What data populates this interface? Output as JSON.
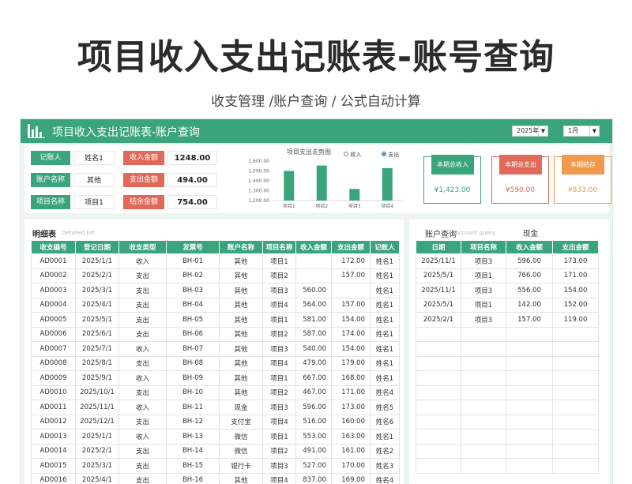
{
  "header": {
    "title": "项目收入支出记账表-账号查询",
    "subtitle": "收支管理  /账户查询  /  公式自动计算"
  },
  "sheet": {
    "title": "项目收入支出记账表-账户查询",
    "year": "2025年",
    "month": "1月"
  },
  "filters": [
    {
      "label": "记账人",
      "value": "姓名1"
    },
    {
      "label": "账户名称",
      "value": "其他"
    },
    {
      "label": "项目名称",
      "value": "项目1"
    }
  ],
  "summary": [
    {
      "label": "收入金额",
      "value": "1248.00"
    },
    {
      "label": "支出金额",
      "value": "494.00"
    },
    {
      "label": "结余金额",
      "value": "754.00"
    }
  ],
  "chart_data": {
    "type": "bar",
    "title": "项目支出走势图",
    "categories": [
      "项目1",
      "项目2",
      "项目3",
      "项目4"
    ],
    "series": [
      {
        "name": "支出",
        "values": [
          1500,
          1555,
          1318,
          1528
        ]
      }
    ],
    "legend": [
      "收入",
      "支出"
    ],
    "legend_placement": "top-right",
    "yticks": [
      "1,600.00",
      "1,500.00",
      "1,400.00",
      "1,300.00",
      "1,200.00"
    ],
    "ylim": [
      1200,
      1600
    ],
    "colors": {
      "bar": "#3aa47a"
    }
  },
  "cards": [
    {
      "label": "本期总收入",
      "value": "¥1,423.00",
      "color": "#3aa47a"
    },
    {
      "label": "本期总支出",
      "value": "¥590.00",
      "color": "#e0695a"
    },
    {
      "label": "本期结存",
      "value": "¥833.00",
      "color": "#f09a4d"
    }
  ],
  "detail": {
    "title": "明细表",
    "subtitle": "Detailed list",
    "columns": [
      "收支编号",
      "登记日期",
      "收支类型",
      "发票号",
      "账户名称",
      "项目名称",
      "收入金额",
      "支出金额",
      "记账人"
    ],
    "rows": [
      [
        "AD0001",
        "2025/1/1",
        "收入",
        "BH-01",
        "其他",
        "项目1",
        "",
        "172.00",
        "姓名1"
      ],
      [
        "AD0002",
        "2025/2/1",
        "支出",
        "BH-02",
        "其他",
        "项目2",
        "",
        "157.00",
        "姓名1"
      ],
      [
        "AD0003",
        "2025/3/1",
        "支出",
        "BH-03",
        "其他",
        "项目3",
        "560.00",
        "",
        "姓名1"
      ],
      [
        "AD0004",
        "2025/4/1",
        "支出",
        "BH-04",
        "其他",
        "项目4",
        "564.00",
        "157.00",
        "姓名1"
      ],
      [
        "AD0005",
        "2025/5/1",
        "支出",
        "BH-05",
        "其他",
        "项目1",
        "581.00",
        "154.00",
        "姓名1"
      ],
      [
        "AD0006",
        "2025/6/1",
        "支出",
        "BH-06",
        "其他",
        "项目2",
        "587.00",
        "174.00",
        "姓名1"
      ],
      [
        "AD0007",
        "2025/7/1",
        "收入",
        "BH-07",
        "其他",
        "项目3",
        "540.00",
        "154.00",
        "姓名1"
      ],
      [
        "AD0008",
        "2025/8/1",
        "支出",
        "BH-08",
        "其他",
        "项目4",
        "479.00",
        "179.00",
        "姓名1"
      ],
      [
        "AD0009",
        "2025/9/1",
        "收入",
        "BH-09",
        "其他",
        "项目1",
        "667.00",
        "168.00",
        "姓名1"
      ],
      [
        "AD0010",
        "2025/10/1",
        "支出",
        "BH-10",
        "其他",
        "项目2",
        "467.00",
        "171.00",
        "姓名4"
      ],
      [
        "AD0011",
        "2025/11/1",
        "收入",
        "BH-11",
        "现金",
        "项目3",
        "596.00",
        "173.00",
        "姓名5"
      ],
      [
        "AD0012",
        "2025/12/1",
        "支出",
        "BH-12",
        "支付宝",
        "项目4",
        "516.00",
        "160.00",
        "姓名6"
      ],
      [
        "AD0013",
        "2025/1/1",
        "收入",
        "BH-13",
        "微信",
        "项目1",
        "553.00",
        "163.00",
        "姓名1"
      ],
      [
        "AD0014",
        "2025/2/1",
        "支出",
        "BH-14",
        "微信",
        "项目2",
        "491.00",
        "161.00",
        "姓名2"
      ],
      [
        "AD0015",
        "2025/3/1",
        "支出",
        "BH-15",
        "银行卡",
        "项目3",
        "527.00",
        "170.00",
        "姓名3"
      ],
      [
        "AD0016",
        "2025/4/1",
        "支出",
        "BH-16",
        "其他",
        "项目4",
        "837.00",
        "169.00",
        "姓名4"
      ]
    ]
  },
  "account": {
    "title": "账户查询",
    "subtitle": "Account query",
    "selected": "现金",
    "columns": [
      "日期",
      "项目名称",
      "收入金额",
      "支出金额"
    ],
    "rows": [
      [
        "2025/11/1",
        "项目3",
        "596.00",
        "173.00"
      ],
      [
        "2025/5/1",
        "项目1",
        "766.00",
        "171.00"
      ],
      [
        "2025/11/1",
        "项目3",
        "556.00",
        "154.00"
      ],
      [
        "2025/5/1",
        "项目1",
        "142.00",
        "152.00"
      ],
      [
        "2025/2/1",
        "项目3",
        "157.00",
        "119.00"
      ]
    ],
    "empty_rows": 10
  }
}
